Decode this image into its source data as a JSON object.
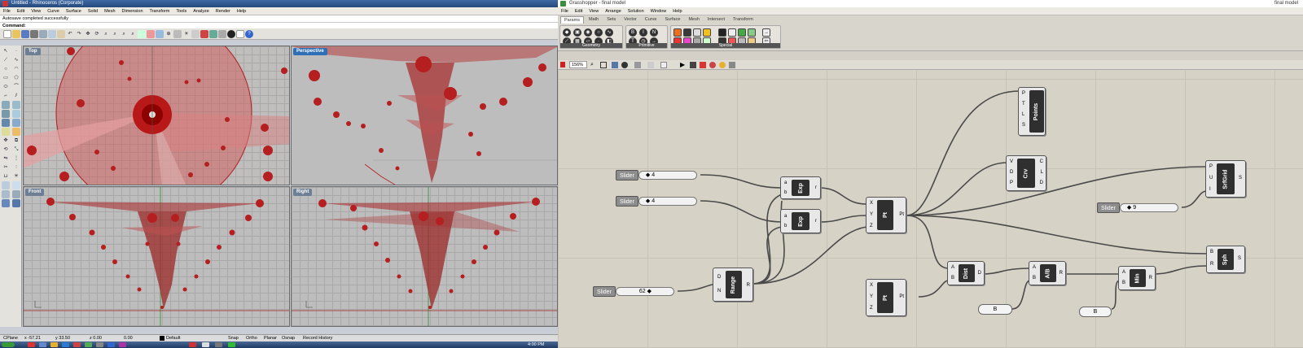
{
  "rhino": {
    "title": "Untitled - Rhinoceros (Corporate)",
    "menu": [
      "File",
      "Edit",
      "View",
      "Curve",
      "Surface",
      "Solid",
      "Mesh",
      "Dimension",
      "Transform",
      "Tools",
      "Analyze",
      "Render",
      "Help"
    ],
    "message": "Autosave completed successfully",
    "command_label": "Command:",
    "viewports": {
      "top": "Top",
      "perspective": "Perspective",
      "front": "Front",
      "right": "Right"
    },
    "status": {
      "cplane": "CPlane",
      "x": "x -57.21",
      "y": "y 33.50",
      "z": "z 0.00",
      "val": "0.00",
      "layer": "Default",
      "snap": "Snap",
      "ortho": "Ortho",
      "planar": "Planar",
      "osnap": "Osnap",
      "record": "Record History"
    },
    "taskbar_time": "4:00 PM"
  },
  "gh": {
    "title": "Grasshopper - final model",
    "title_right": "final model",
    "menu": [
      "File",
      "Edit",
      "View",
      "Arrange",
      "Solution",
      "Window",
      "Help"
    ],
    "tabs": [
      "Params",
      "Math",
      "Sets",
      "Vector",
      "Curve",
      "Surface",
      "Mesh",
      "Intersect",
      "Transform"
    ],
    "groups": [
      "Geometry",
      "Primitive",
      "Special"
    ],
    "zoom": "156%",
    "sliders": {
      "s1": {
        "label": "Slider",
        "value": "4"
      },
      "s2": {
        "label": "Slider",
        "value": "4"
      },
      "s3": {
        "label": "Slider",
        "value": "62"
      },
      "s4": {
        "label": "Slider",
        "value": "9"
      }
    },
    "components": {
      "exp1": {
        "name": "Exp",
        "inputs": [
          "a",
          "b"
        ],
        "outputs": [
          "r"
        ]
      },
      "exp2": {
        "name": "Exp",
        "inputs": [
          "a",
          "b"
        ],
        "outputs": [
          "r"
        ]
      },
      "range": {
        "name": "Range",
        "inputs": [
          "D",
          "N"
        ],
        "outputs": [
          "R"
        ]
      },
      "pt1": {
        "name": "Pt",
        "inputs": [
          "X",
          "Y",
          "Z"
        ],
        "outputs": [
          "Pt"
        ]
      },
      "pt2": {
        "name": "Pt",
        "inputs": [
          "X",
          "Y",
          "Z"
        ],
        "outputs": [
          "Pt"
        ]
      },
      "points": {
        "name": "Points",
        "inputs": [
          "P",
          "T",
          "L",
          "S"
        ],
        "outputs": []
      },
      "crv": {
        "name": "Crv",
        "inputs": [
          "V",
          "D",
          "P"
        ],
        "outputs": [
          "C",
          "L",
          "D"
        ]
      },
      "srfgrid": {
        "name": "SrfGrid",
        "inputs": [
          "P",
          "U",
          "I"
        ],
        "outputs": [
          "S"
        ]
      },
      "sph": {
        "name": "Sph",
        "inputs": [
          "B",
          "R"
        ],
        "outputs": [
          "S"
        ]
      },
      "dist": {
        "name": "Dist",
        "inputs": [
          "A",
          "B"
        ],
        "outputs": [
          "D"
        ]
      },
      "div": {
        "name": "A/B",
        "inputs": [
          "A",
          "B"
        ],
        "outputs": [
          "R"
        ]
      },
      "min": {
        "name": "Min",
        "inputs": [
          "A",
          "B"
        ],
        "outputs": [
          "R"
        ]
      }
    },
    "panels": {
      "b1": "B",
      "b2": "B"
    }
  }
}
